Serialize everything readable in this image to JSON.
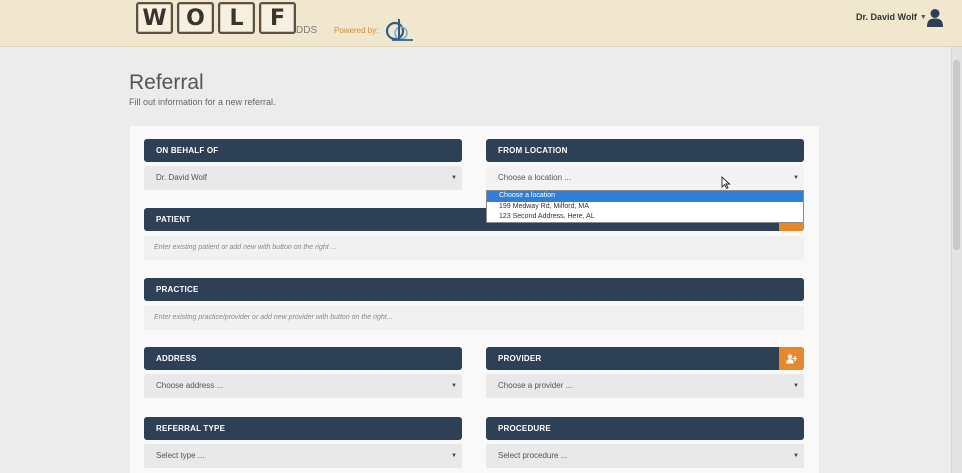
{
  "header": {
    "logo_letters": [
      "W",
      "O",
      "L",
      "F"
    ],
    "logo_suffix": "DDS",
    "powered_by": "Powered by:",
    "user_name": "Dr. David Wolf"
  },
  "page": {
    "title": "Referral",
    "subtitle": "Fill out information for a new referral."
  },
  "form": {
    "on_behalf_of": {
      "label": "ON BEHALF OF",
      "value": "Dr. David Wolf"
    },
    "from_location": {
      "label": "FROM LOCATION",
      "value": "Choose a location ...",
      "options": [
        "Choose a location",
        "199 Medway Rd, Milford, MA",
        "123 Second Address, Here, AL"
      ],
      "selected_index": 0
    },
    "patient": {
      "label": "PATIENT",
      "placeholder": "Enter existing patient or add new with button on the right ..."
    },
    "practice": {
      "label": "PRACTICE",
      "placeholder": "Enter existing practice/provider or add new provider with button on the right..."
    },
    "address": {
      "label": "ADDRESS",
      "value": "Choose address ..."
    },
    "provider": {
      "label": "PROVIDER",
      "value": "Choose a provider ..."
    },
    "referral_type": {
      "label": "REFERRAL TYPE",
      "value": "Select type ..."
    },
    "procedure": {
      "label": "PROCEDURE",
      "value": "Select procedure ..."
    }
  },
  "colors": {
    "header_bg": "#f1e7cf",
    "section_header": "#2d4056",
    "accent_orange": "#e6892d",
    "dropdown_highlight": "#2f7fd8"
  }
}
